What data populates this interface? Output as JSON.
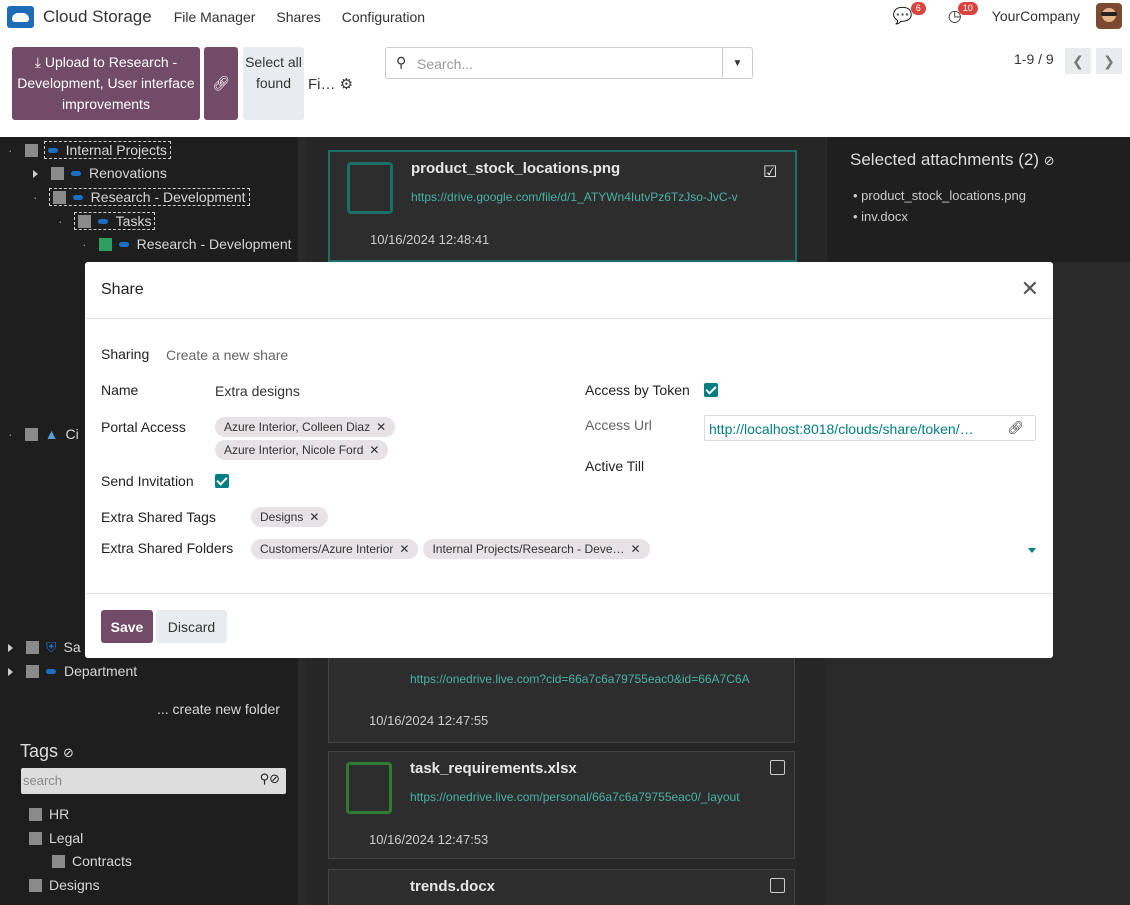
{
  "app": {
    "name": "Cloud Storage",
    "company": "YourCompany"
  },
  "nav": {
    "menu": [
      "File Manager",
      "Shares",
      "Configuration"
    ],
    "messages_count": "6",
    "activities_count": "10"
  },
  "control": {
    "upload_label": "Upload to Research - Development, User interface improvements",
    "select_all_label": "Select all found",
    "fi_label": "Fi…",
    "search_placeholder": "Search...",
    "pager": "1-9 / 9"
  },
  "tree": {
    "items": [
      "Internal Projects",
      "Renovations",
      "Research - Development",
      "Tasks",
      "Research - Development",
      "Ci",
      "Sa",
      "Department"
    ],
    "create_folder": "... create new folder"
  },
  "tags": {
    "title": "Tags",
    "search_placeholder": "search",
    "items": [
      "HR",
      "Legal",
      "Contracts",
      "Designs"
    ]
  },
  "cards": [
    {
      "name": "product_stock_locations.png",
      "url": "https://drive.google.com/file/d/1_ATYWn4IutvPz6TzJso-JvC-v",
      "date": "10/16/2024 12:48:41"
    },
    {
      "name": "",
      "url": "https://onedrive.live.com?cid=66a7c6a79755eac0&id=66A7C6A",
      "date": "10/16/2024 12:47:55"
    },
    {
      "name": "task_requirements.xlsx",
      "url": "https://onedrive.live.com/personal/66a7c6a79755eac0/_layout",
      "date": "10/16/2024 12:47:53"
    },
    {
      "name": "trends.docx",
      "url": "",
      "date": ""
    }
  ],
  "selection": {
    "title": "Selected attachments (2)",
    "items": [
      "product_stock_locations.png",
      "inv.docx"
    ]
  },
  "modal": {
    "title": "Share",
    "sharing_label": "Sharing",
    "sharing_value": "Create a new share",
    "name_label": "Name",
    "name_value": "Extra designs",
    "portal_label": "Portal Access",
    "portal_tags": [
      "Azure Interior, Colleen Diaz",
      "Azure Interior, Nicole Ford"
    ],
    "send_invitation_label": "Send Invitation",
    "send_invitation": true,
    "extra_tags_label": "Extra Shared Tags",
    "extra_tags": [
      "Designs"
    ],
    "extra_folders_label": "Extra Shared Folders",
    "extra_folders": [
      "Customers/Azure Interior",
      "Internal Projects/Research - Deve…"
    ],
    "access_token_label": "Access by Token",
    "access_token": true,
    "access_url_label": "Access Url",
    "access_url_value": "http://localhost:8018/clouds/share/token/…",
    "active_till_label": "Active Till",
    "save_label": "Save",
    "discard_label": "Discard"
  },
  "colors": {
    "primary": "#714b67",
    "accent": "#017e84"
  }
}
